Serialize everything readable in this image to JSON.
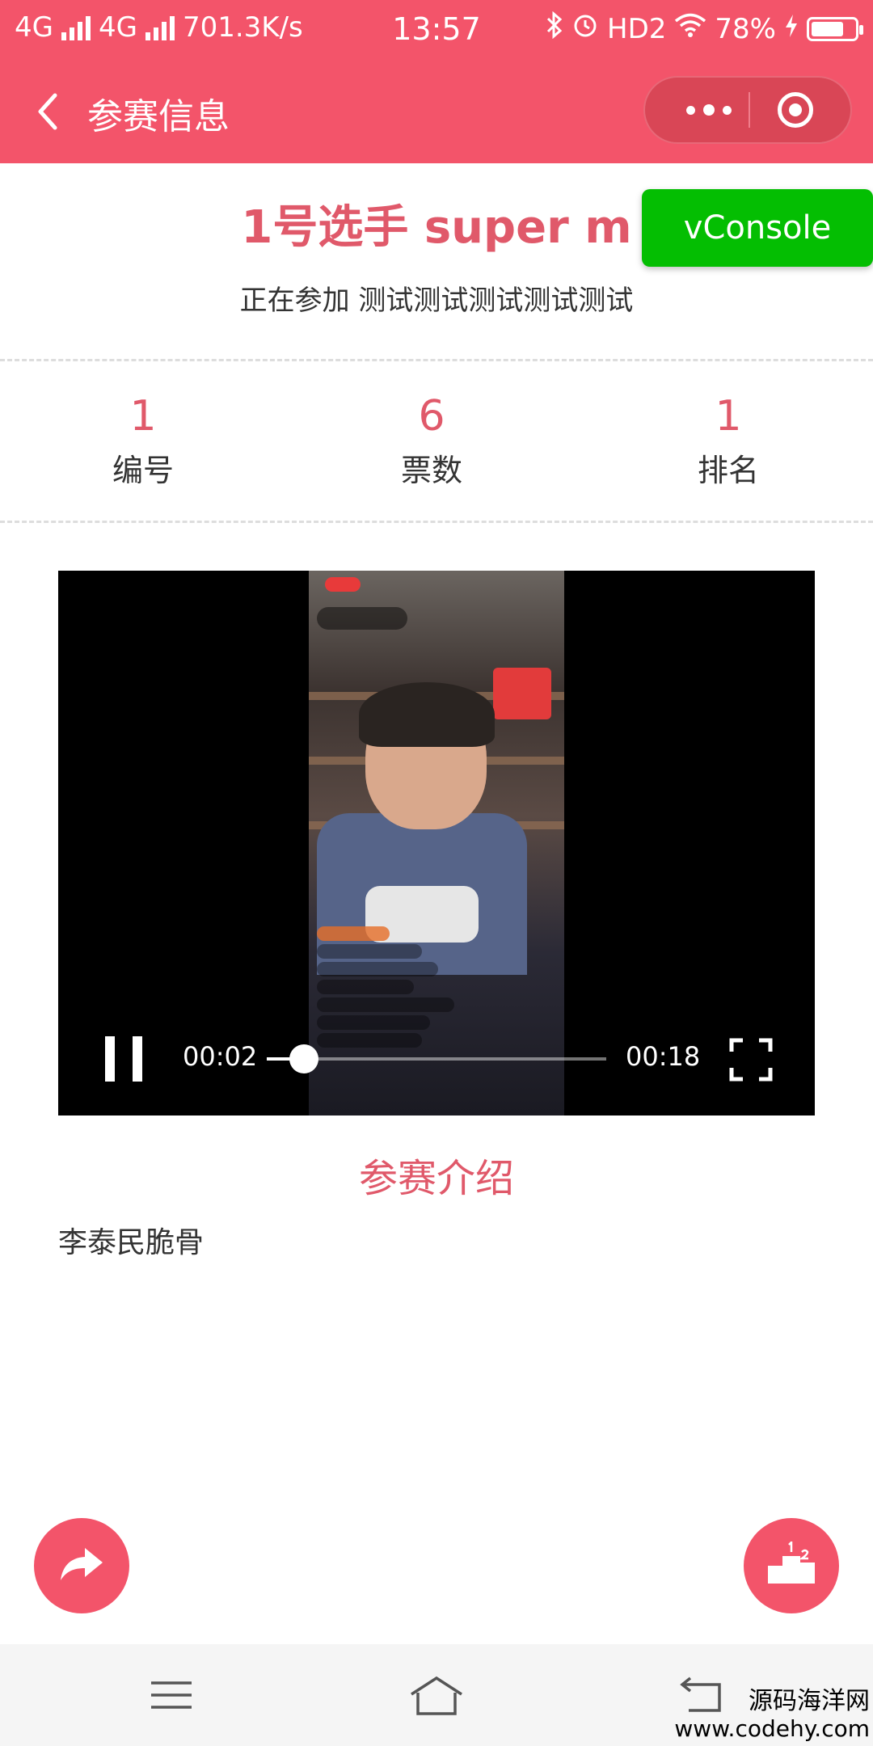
{
  "status_bar": {
    "network1": "4G",
    "network2": "4G",
    "speed": "701.3K/s",
    "time": "13:57",
    "hd": "HD2",
    "battery": "78%",
    "battery_level": 0.78
  },
  "nav": {
    "title": "参赛信息"
  },
  "contestant": {
    "title": "1号选手 super m",
    "subtitle": "正在参加 测试测试测试测试测试"
  },
  "vconsole_label": "vConsole",
  "stats": [
    {
      "value": "1",
      "label": "编号"
    },
    {
      "value": "6",
      "label": "票数"
    },
    {
      "value": "1",
      "label": "排名"
    }
  ],
  "video": {
    "current_time": "00:02",
    "duration": "00:18",
    "progress": 0.11
  },
  "intro": {
    "title": "参赛介绍",
    "text": "李泰民脆骨"
  },
  "watermark": {
    "line1": "源码海洋网",
    "line2": "www.codehy.com"
  },
  "colors": {
    "brand": "#f3546a",
    "accent_text": "#e0596a",
    "vconsole": "#04be02"
  }
}
